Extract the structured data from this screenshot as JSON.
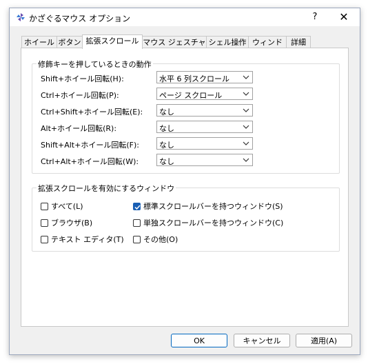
{
  "window": {
    "title": "かざぐるマウス オプション",
    "help_glyph": "?",
    "close_glyph": "✕"
  },
  "tabs": [
    {
      "label": "ホイール"
    },
    {
      "label": "ボタン"
    },
    {
      "label": "拡張スクロール",
      "active": true
    },
    {
      "label": "マウス ジェスチャー"
    },
    {
      "label": "シェル操作"
    },
    {
      "label": "ウィンドウ"
    },
    {
      "label": "詳細"
    }
  ],
  "modifier_group": {
    "legend": "修飾キーを押しているときの動作",
    "rows": [
      {
        "label": "Shift+ホイール回転(H):",
        "value": "水平 6 列スクロール"
      },
      {
        "label": "Ctrl+ホイール回転(P):",
        "value": "ページ スクロール"
      },
      {
        "label": "Ctrl+Shift+ホイール回転(E):",
        "value": "なし"
      },
      {
        "label": "Alt+ホイール回転(R):",
        "value": "なし"
      },
      {
        "label": "Shift+Alt+ホイール回転(F):",
        "value": "なし"
      },
      {
        "label": "Ctrl+Alt+ホイール回転(W):",
        "value": "なし"
      }
    ]
  },
  "window_group": {
    "legend": "拡張スクロールを有効にするウィンドウ",
    "checks": [
      {
        "label": "すべて(L)",
        "checked": false
      },
      {
        "label": "標準スクロールバーを持つウィンドウ(S)",
        "checked": true
      },
      {
        "label": "ブラウザ(B)",
        "checked": false
      },
      {
        "label": "単独スクロールバーを持つウィンドウ(C)",
        "checked": false
      },
      {
        "label": "テキスト エディタ(T)",
        "checked": false
      },
      {
        "label": "その他(O)",
        "checked": false
      }
    ]
  },
  "buttons": {
    "ok": "OK",
    "cancel": "キャンセル",
    "apply": "適用(A)"
  },
  "colors": {
    "accent": "#1a5fb4",
    "dialog_bg": "#f0f0f0",
    "panel_bg": "#ffffff"
  }
}
